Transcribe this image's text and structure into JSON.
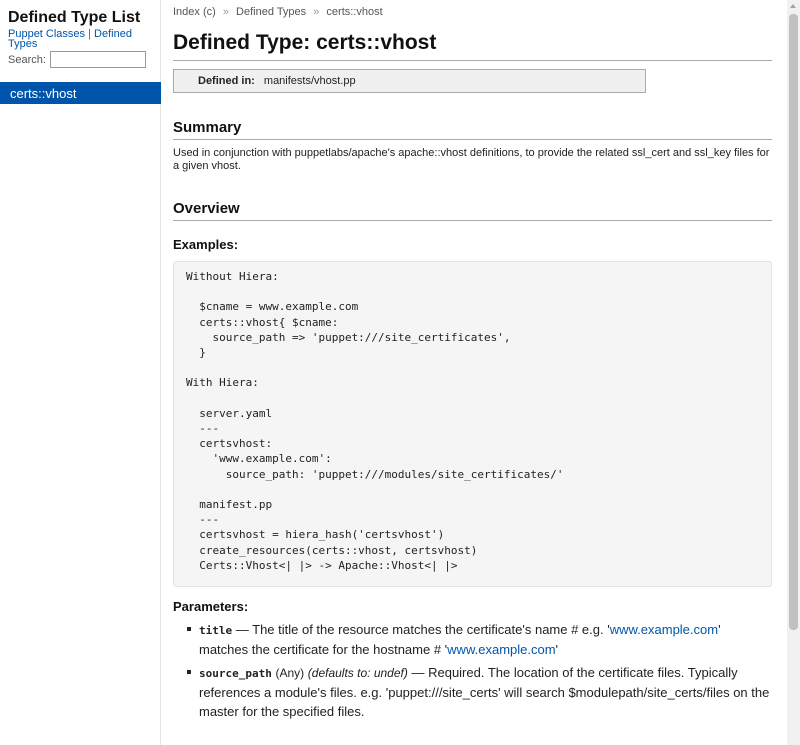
{
  "sidebar": {
    "title": "Defined Type List",
    "links": {
      "classes": "Puppet Classes",
      "separator": "|",
      "types": "Defined Types"
    },
    "search_label": "Search:",
    "search_value": "",
    "items": [
      {
        "label": "certs::vhost"
      }
    ]
  },
  "breadcrumb": {
    "items": [
      "Index (c)",
      "Defined Types",
      "certs::vhost"
    ],
    "separator": "»"
  },
  "page": {
    "title": "Defined Type: certs::vhost",
    "defined_in_label": "Defined in:",
    "defined_in_value": "manifests/vhost.pp",
    "summary_heading": "Summary",
    "summary_text": "Used in conjunction with puppetlabs/apache's apache::vhost definitions, to provide the related ssl_cert and ssl_key files for a given vhost.",
    "overview_heading": "Overview",
    "examples_heading": "Examples:",
    "example_code": "Without Hiera:\n\n  $cname = www.example.com\n  certs::vhost{ $cname:\n    source_path => 'puppet:///site_certificates',\n  }\n\nWith Hiera:\n\n  server.yaml\n  ---\n  certsvhost:\n    'www.example.com':\n      source_path: 'puppet:///modules/site_certificates/'\n\n  manifest.pp\n  ---\n  certsvhost = hiera_hash('certsvhost')\n  create_resources(certs::vhost, certsvhost)\n  Certs::Vhost<| |> -> Apache::Vhost<| |>",
    "parameters_heading": "Parameters:",
    "parameters": [
      {
        "name": "title",
        "dash": " — ",
        "text1": "The title of the resource matches the certificate's name # e.g. '",
        "link1": "www.example.com",
        "text2": "' matches the certificate for the hostname # '",
        "link2": "www.example.com",
        "text3": "'"
      },
      {
        "name": "source_path",
        "type": "(Any)",
        "default_prefix": "(defaults to: ",
        "default_value": "undef",
        "default_suffix": ")",
        "dash": " — ",
        "text": "Required. The location of the certificate files. Typically references a module's files. e.g. 'puppet:///site_certs' will search $modulepath/site_certs/files on the master for the specified files."
      }
    ]
  },
  "colors": {
    "link": "#0055aa",
    "selected_bg": "#0055aa",
    "defined_in_bg": "#f0f0f0",
    "code_bg": "#f5f5f5"
  },
  "icons": {
    "scroll_up": "chevron-up-icon"
  }
}
